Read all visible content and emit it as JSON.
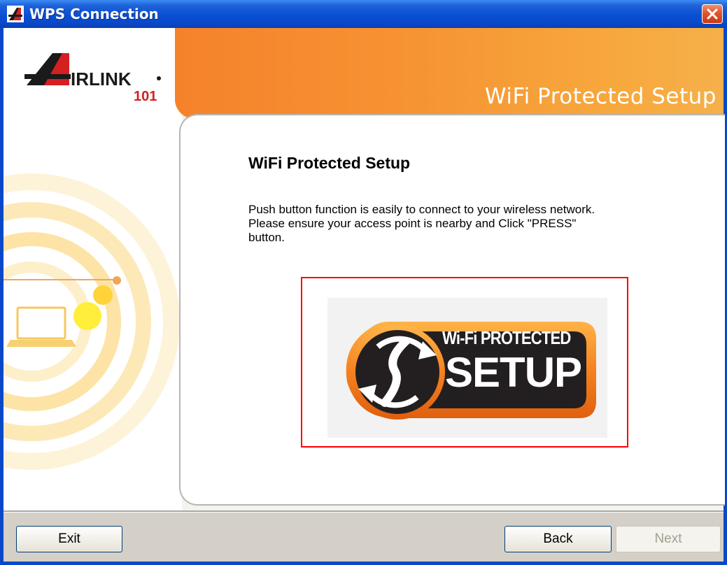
{
  "window": {
    "title": "WPS Connection"
  },
  "brand": {
    "logo_text": "AIRLINK",
    "logo_number": "101"
  },
  "banner": {
    "title": "WiFi Protected Setup"
  },
  "content": {
    "heading": "WiFi Protected Setup",
    "description_lines": [
      "Push button function is easily to connect to your wireless network.",
      "Please ensure your access point is nearby and Click \"PRESS\"",
      "button."
    ]
  },
  "wps_button": {
    "logo_line1": "Wi-Fi PROTECTED",
    "logo_line2": "SETUP"
  },
  "buttons": {
    "exit": "Exit",
    "back": "Back",
    "next": "Next",
    "next_enabled": false
  },
  "colors": {
    "title_bar": "#0a48c8",
    "banner": "#f69433",
    "highlight_border": "#ff0000",
    "close_button": "#e2552e"
  }
}
